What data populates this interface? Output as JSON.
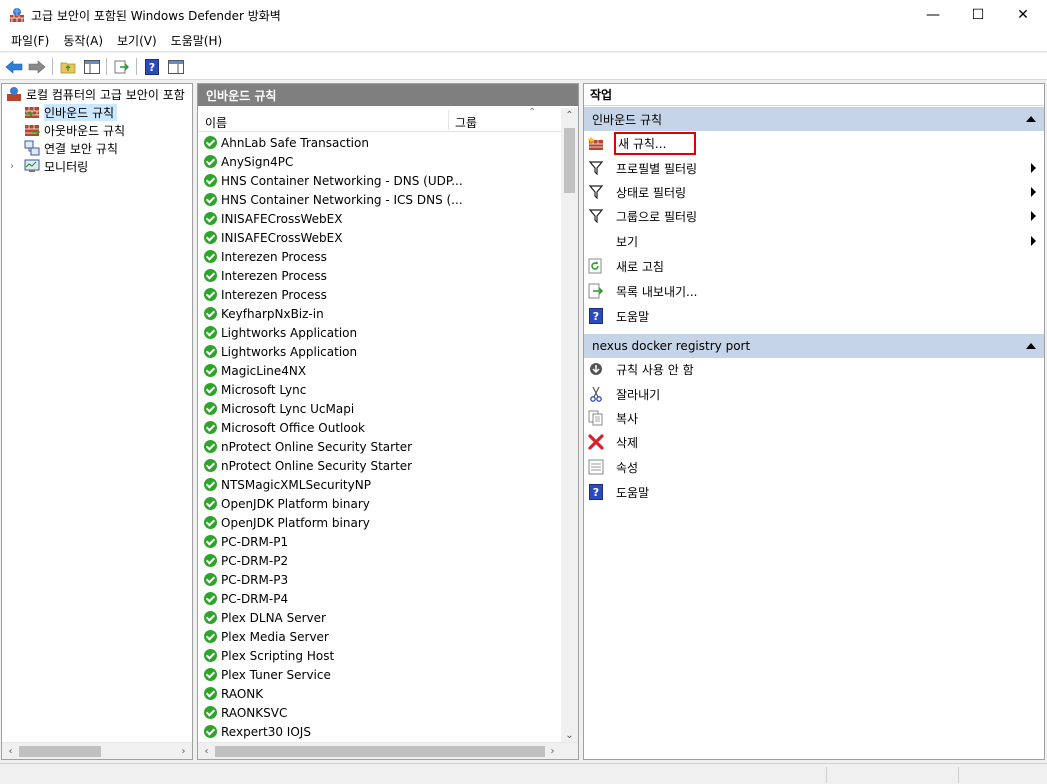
{
  "window": {
    "title": "고급 보안이 포함된 Windows Defender 방화벽",
    "minimize": "—",
    "maximize": "☐",
    "close": "✕"
  },
  "menu": [
    "파일(F)",
    "동작(A)",
    "보기(V)",
    "도움말(H)"
  ],
  "tree": {
    "root": "로컬 컴퓨터의 고급 보안이 포함",
    "items": [
      "인바운드 규칙",
      "아웃바운드 규칙",
      "연결 보안 규칙",
      "모니터링"
    ]
  },
  "rules_panel": {
    "header": "인바운드 규칙",
    "col_name": "이름",
    "col_group": "그룹",
    "rules": [
      "AhnLab Safe Transaction",
      "AnySign4PC",
      "HNS Container Networking - DNS (UDP...",
      "HNS Container Networking - ICS DNS (...",
      "INISAFECrossWebEX",
      "INISAFECrossWebEX",
      "Interezen Process",
      "Interezen Process",
      "Interezen Process",
      "KeyfharpNxBiz-in",
      "Lightworks Application",
      "Lightworks Application",
      "MagicLine4NX",
      "Microsoft Lync",
      "Microsoft Lync UcMapi",
      "Microsoft Office Outlook",
      "nProtect Online Security Starter",
      "nProtect Online Security Starter",
      "NTSMagicXMLSecurityNP",
      "OpenJDK Platform binary",
      "OpenJDK Platform binary",
      "PC-DRM-P1",
      "PC-DRM-P2",
      "PC-DRM-P3",
      "PC-DRM-P4",
      "Plex DLNA Server",
      "Plex Media Server",
      "Plex Scripting Host",
      "Plex Tuner Service",
      "RAONK",
      "RAONKSVC",
      "Rexpert30 IOJS"
    ]
  },
  "actions_panel": {
    "header": "작업",
    "section1": {
      "title": "인바운드 규칙",
      "items": [
        {
          "label": "새 규칙...",
          "icon": "new-rule-icon"
        },
        {
          "label": "프로필별 필터링",
          "icon": "filter-icon"
        },
        {
          "label": "상태로 필터링",
          "icon": "filter-icon"
        },
        {
          "label": "그룹으로 필터링",
          "icon": "filter-icon"
        },
        {
          "label": "보기",
          "icon": ""
        },
        {
          "label": "새로 고침",
          "icon": "refresh-icon"
        },
        {
          "label": "목록 내보내기...",
          "icon": "export-icon"
        },
        {
          "label": "도움말",
          "icon": "help-icon"
        }
      ]
    },
    "section2": {
      "title": "nexus docker registry port",
      "items": [
        {
          "label": "규칙 사용 안 함",
          "icon": "disable-icon"
        },
        {
          "label": "잘라내기",
          "icon": "cut-icon"
        },
        {
          "label": "복사",
          "icon": "copy-icon"
        },
        {
          "label": "삭제",
          "icon": "delete-icon"
        },
        {
          "label": "속성",
          "icon": "properties-icon"
        },
        {
          "label": "도움말",
          "icon": "help-icon"
        }
      ]
    }
  },
  "colors": {
    "accent_section": "#c6d4e7",
    "panel_header": "#7f7f7f",
    "check_green": "#2ea42a",
    "highlight_red": "#e00000"
  }
}
